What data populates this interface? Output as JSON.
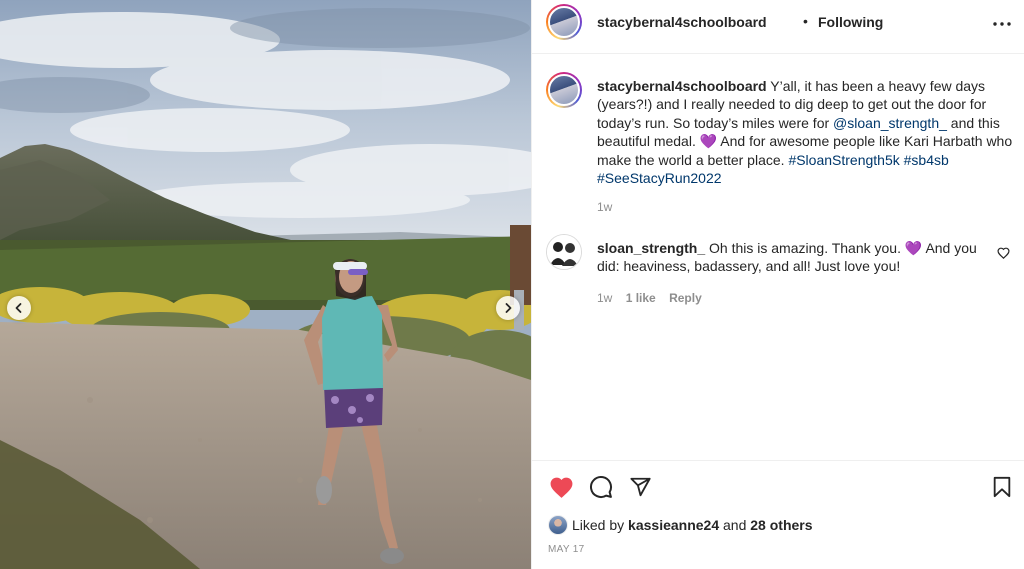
{
  "post": {
    "username": "stacybernal4schoolboard",
    "separator": "•",
    "follow_status": "Following"
  },
  "caption": {
    "username": "stacybernal4schoolboard",
    "text_1": "Y’all, it has been a heavy few days (years?!) and I really needed to dig deep to get out the door for today’s run. So today’s miles were for",
    "mention": "@sloan_strength_",
    "text_2": "and this beautiful medal.",
    "emoji": "💜",
    "text_3": "And for awesome people like Kari Harbath who make the world a better place.",
    "hashtags": [
      "#SloanStrength5k",
      "#sb4sb",
      "#SeeStacyRun2022"
    ],
    "age": "1w"
  },
  "comment": {
    "username": "sloan_strength_",
    "text_1": "Oh this is amazing. Thank you.",
    "emoji": "💜",
    "text_2": "And you did: heaviness, badassery, and all! Just love you!",
    "age": "1w",
    "likes": "1 like",
    "reply": "Reply"
  },
  "engagement": {
    "liked_prefix": "Liked by",
    "liked_user": "kassieanne24",
    "and": "and",
    "others": "28 others",
    "date": "MAY 17"
  },
  "icons": {
    "more": "more-horizontal-icon",
    "like": "heart-filled-icon",
    "comment": "comment-bubble-icon",
    "share": "paper-plane-icon",
    "save": "bookmark-icon",
    "comment_like": "heart-outline-icon",
    "prev": "chevron-left-icon",
    "next": "chevron-right-icon"
  },
  "colors": {
    "like_red": "#ed4956",
    "link_blue": "#00376b",
    "muted": "#8e8e8e",
    "emoji_purple": "#a855f7"
  }
}
